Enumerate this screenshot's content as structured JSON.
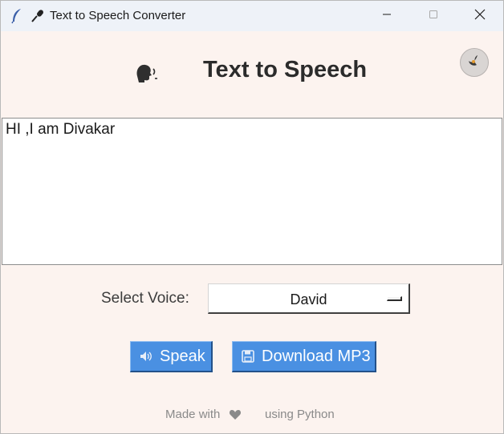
{
  "window": {
    "title": "Text to Speech Converter",
    "title_emoji_icon": "microphone-icon",
    "app_icon": "feather-icon"
  },
  "header": {
    "title": "Text to Speech",
    "icon": "speaking-head-icon",
    "theme_toggle_icon": "crescent-moon-icon"
  },
  "editor": {
    "text": "HI ,I am Divakar"
  },
  "voice": {
    "label": "Select Voice:",
    "selected": "David"
  },
  "buttons": {
    "speak_label": "Speak",
    "speak_icon": "speaker-icon",
    "download_label": "Download MP3",
    "download_icon": "floppy-disk-icon"
  },
  "footer": {
    "made_with": "Made with",
    "heart_icon": "heart-icon",
    "using": "using Python"
  },
  "colors": {
    "background": "#fcf3ef",
    "button": "#4a90e2",
    "titlebar": "#eef2f8"
  }
}
